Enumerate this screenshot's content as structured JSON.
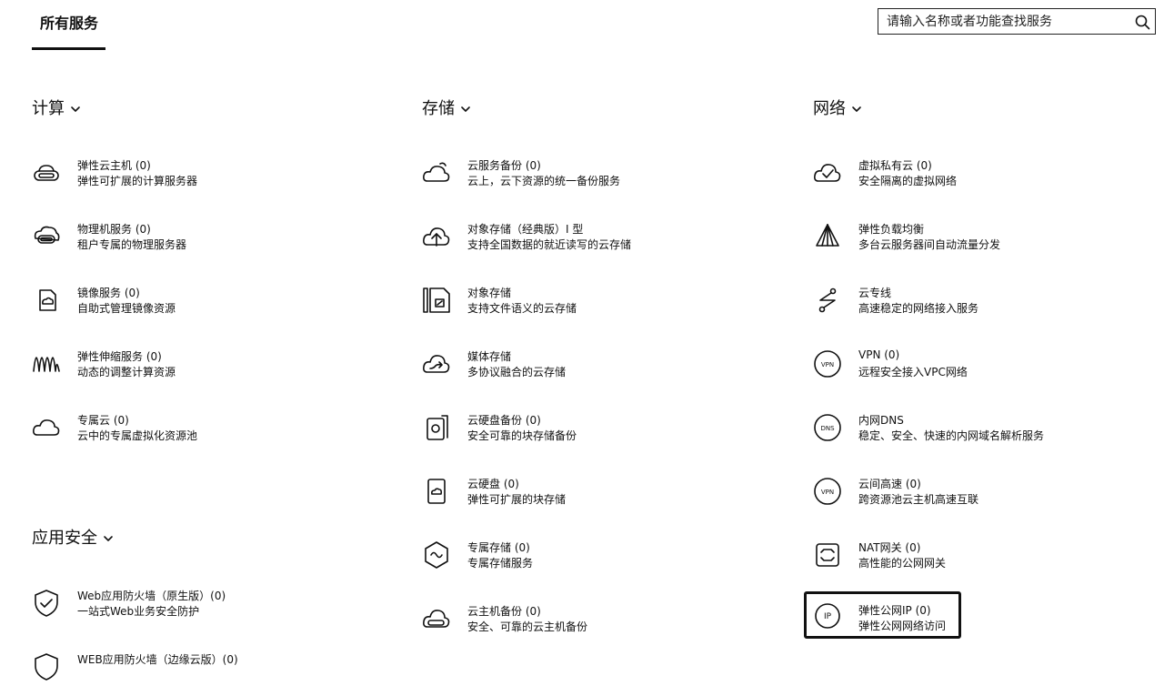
{
  "tabs": {
    "active": "所有服务"
  },
  "search": {
    "placeholder": "请输入名称或者功能查找服务"
  },
  "sections": {
    "compute": {
      "title": "计算",
      "items": [
        {
          "name": "弹性云主机 (0)",
          "desc": "弹性可扩展的计算服务器",
          "icon": "server-icon"
        },
        {
          "name": "物理机服务 (0)",
          "desc": "租户专属的物理服务器",
          "icon": "physical-server-icon"
        },
        {
          "name": "镜像服务 (0)",
          "desc": "自助式管理镜像资源",
          "icon": "image-icon"
        },
        {
          "name": "弹性伸缩服务 (0)",
          "desc": "动态的调整计算资源",
          "icon": "autoscale-icon"
        },
        {
          "name": "专属云 (0)",
          "desc": "云中的专属虚拟化资源池",
          "icon": "cloud-icon"
        }
      ]
    },
    "storage": {
      "title": "存储",
      "items": [
        {
          "name": "云服务备份 (0)",
          "desc": "云上，云下资源的统一备份服务",
          "icon": "cloud-backup-icon"
        },
        {
          "name": "对象存储（经典版）I 型",
          "desc": "支持全国数据的就近读写的云存储",
          "icon": "cloud-upload-icon"
        },
        {
          "name": "对象存储",
          "desc": "支持文件语义的云存储",
          "icon": "object-storage-icon"
        },
        {
          "name": "媒体存储",
          "desc": "多协议融合的云存储",
          "icon": "media-storage-icon"
        },
        {
          "name": "云硬盘备份 (0)",
          "desc": "安全可靠的块存储备份",
          "icon": "disk-backup-icon"
        },
        {
          "name": "云硬盘 (0)",
          "desc": "弹性可扩展的块存储",
          "icon": "disk-icon"
        },
        {
          "name": "专属存储 (0)",
          "desc": "专属存储服务",
          "icon": "dedicated-storage-icon"
        },
        {
          "name": "云主机备份 (0)",
          "desc": "安全、可靠的云主机备份",
          "icon": "host-backup-icon"
        }
      ]
    },
    "network": {
      "title": "网络",
      "items": [
        {
          "name": "虚拟私有云 (0)",
          "desc": "安全隔离的虚拟网络",
          "icon": "vpc-icon"
        },
        {
          "name": "弹性负载均衡",
          "desc": "多台云服务器间自动流量分发",
          "icon": "load-balancer-icon"
        },
        {
          "name": "云专线",
          "desc": "高速稳定的网络接入服务",
          "icon": "direct-connect-icon"
        },
        {
          "name": "VPN (0)",
          "desc": "远程安全接入VPC网络",
          "icon": "vpn-icon"
        },
        {
          "name": "内网DNS",
          "desc": "稳定、安全、快速的内网域名解析服务",
          "icon": "dns-icon"
        },
        {
          "name": "云间高速 (0)",
          "desc": "跨资源池云主机高速互联",
          "icon": "cloud-connect-icon"
        },
        {
          "name": "NAT网关 (0)",
          "desc": "高性能的公网网关",
          "icon": "nat-gateway-icon"
        },
        {
          "name": "弹性公网IP (0)",
          "desc": "弹性公网网络访问",
          "icon": "eip-icon"
        }
      ]
    },
    "security": {
      "title": "应用安全",
      "items": [
        {
          "name": "Web应用防火墙（原生版）(0)",
          "desc": "一站式Web业务安全防护",
          "icon": "waf-shield-icon"
        },
        {
          "name": "WEB应用防火墙（边缘云版）(0)",
          "desc": "",
          "icon": "waf-shield-icon"
        }
      ]
    }
  }
}
